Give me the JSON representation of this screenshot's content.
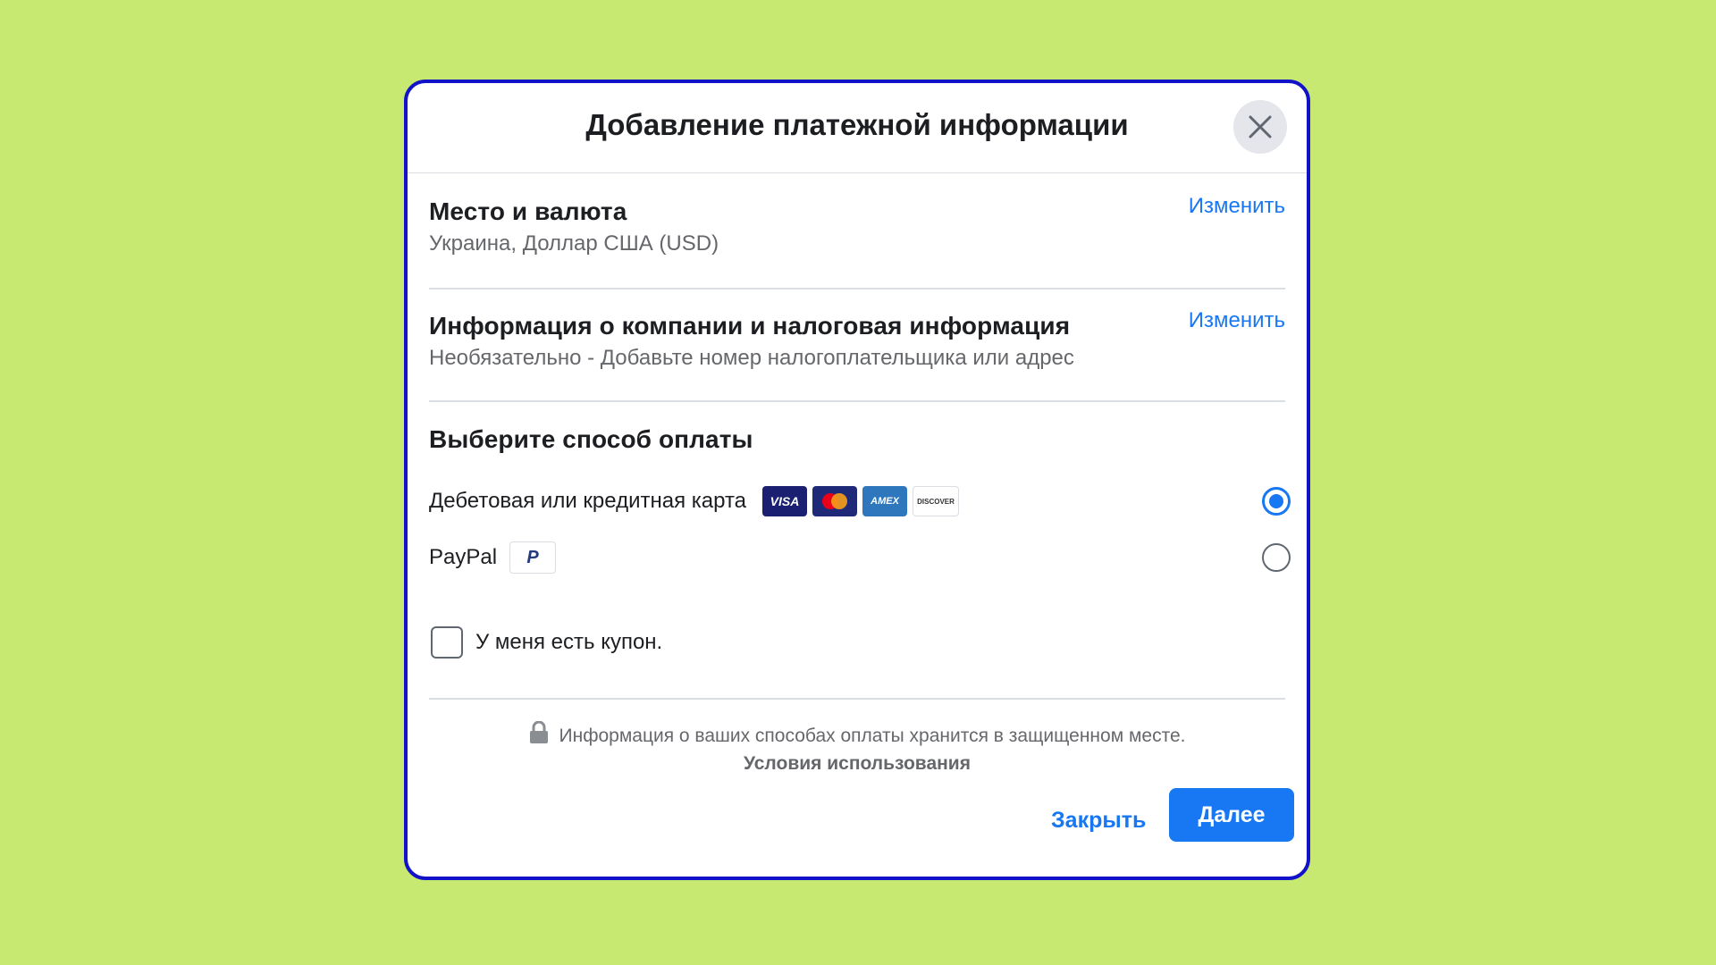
{
  "dialog": {
    "title": "Добавление платежной информации",
    "close_icon": "close-icon"
  },
  "location": {
    "title": "Место и валюта",
    "subtitle": "Украина, Доллар США (USD)",
    "edit_label": "Изменить"
  },
  "company": {
    "title": "Информация о компании и налоговая информация",
    "subtitle": "Необязательно - Добавьте номер налогоплательщика или адрес",
    "edit_label": "Изменить"
  },
  "payment": {
    "title": "Выберите способ оплаты",
    "options": [
      {
        "label": "Дебетовая или кредитная карта",
        "selected": true,
        "logos": [
          {
            "name": "visa-logo",
            "text": "VISA"
          },
          {
            "name": "mastercard-logo",
            "text": ""
          },
          {
            "name": "amex-logo",
            "text": "AMEX"
          },
          {
            "name": "discover-logo",
            "text": "DISCOVER"
          }
        ]
      },
      {
        "label": "PayPal",
        "selected": false,
        "logos": [
          {
            "name": "paypal-logo",
            "text": "P"
          }
        ]
      }
    ]
  },
  "coupon": {
    "label": "У меня есть купон.",
    "checked": false
  },
  "footer": {
    "note": "Информация о ваших способах оплаты хранится в защищенном месте.",
    "lock_icon": "lock-icon",
    "terms_label": "Условия использования",
    "close_label": "Закрыть",
    "next_label": "Далее"
  },
  "colors": {
    "background": "#c8e971",
    "dialog_border": "#1212c8",
    "accent": "#1877f2",
    "visa": "#1a1f71",
    "mastercard_bg": "#1e2a78",
    "amex": "#2e77bc"
  }
}
